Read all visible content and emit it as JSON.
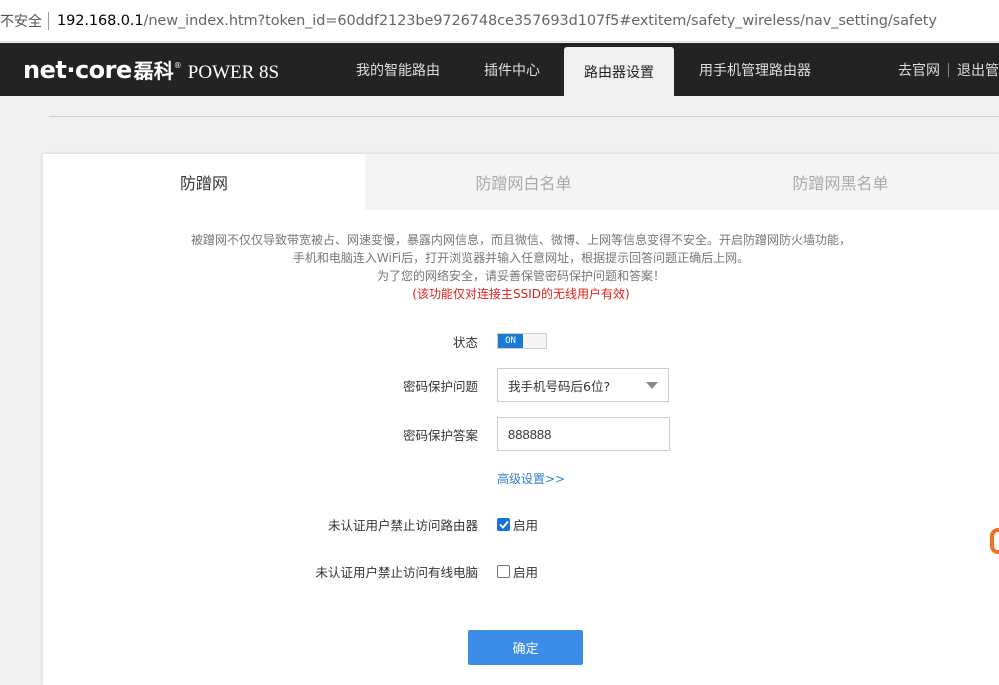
{
  "addressbar": {
    "security": "不安全",
    "url_host": "192.168.0.1",
    "url_path": "/new_index.htm?token_id=60ddf2123be9726748ce357693d107f5#extitem/safety_wireless/nav_setting/safety"
  },
  "header": {
    "brand": "net·core",
    "brand_cn": "磊科",
    "registered": "®",
    "model": "POWER 8S",
    "tabs": [
      {
        "label": "我的智能路由"
      },
      {
        "label": "插件中心"
      },
      {
        "label": "路由器设置"
      },
      {
        "label": "用手机管理路由器"
      }
    ],
    "right_links": [
      {
        "label": "去官网"
      },
      {
        "label": "退出管"
      }
    ]
  },
  "panel": {
    "tabs": [
      {
        "label": "防蹭网"
      },
      {
        "label": "防蹭网白名单"
      },
      {
        "label": "防蹭网黑名单"
      }
    ],
    "description": [
      "被蹭网不仅仅导致带宽被占、网速变慢，暴露内网信息，而且微信、微博、上网等信息变得不安全。开启防蹭网防火墙功能，",
      "手机和电脑连入WiFi后，打开浏览器并输入任意网址，根据提示回答问题正确后上网。",
      "为了您的网络安全，请妥善保管密码保护问题和答案！"
    ],
    "warning": "(该功能仅对连接主SSID的无线用户有效)",
    "status": {
      "label": "状态",
      "value": "ON"
    },
    "question": {
      "label": "密码保护问题",
      "value": "我手机号码后6位?"
    },
    "answer": {
      "label": "密码保护答案",
      "value": "888888"
    },
    "advanced": "高级设置>>",
    "block_router": {
      "label": "未认证用户禁止访问路由器",
      "option": "启用",
      "checked": true
    },
    "block_wired": {
      "label": "未认证用户禁止访问有线电脑",
      "option": "启用",
      "checked": false
    },
    "confirm": "确定"
  },
  "colors": {
    "nav_bg": "#232323",
    "accent": "#3d8ce8",
    "toggle_on": "#1a7bd6",
    "warning": "#e02020",
    "link": "#2e7fd0"
  }
}
